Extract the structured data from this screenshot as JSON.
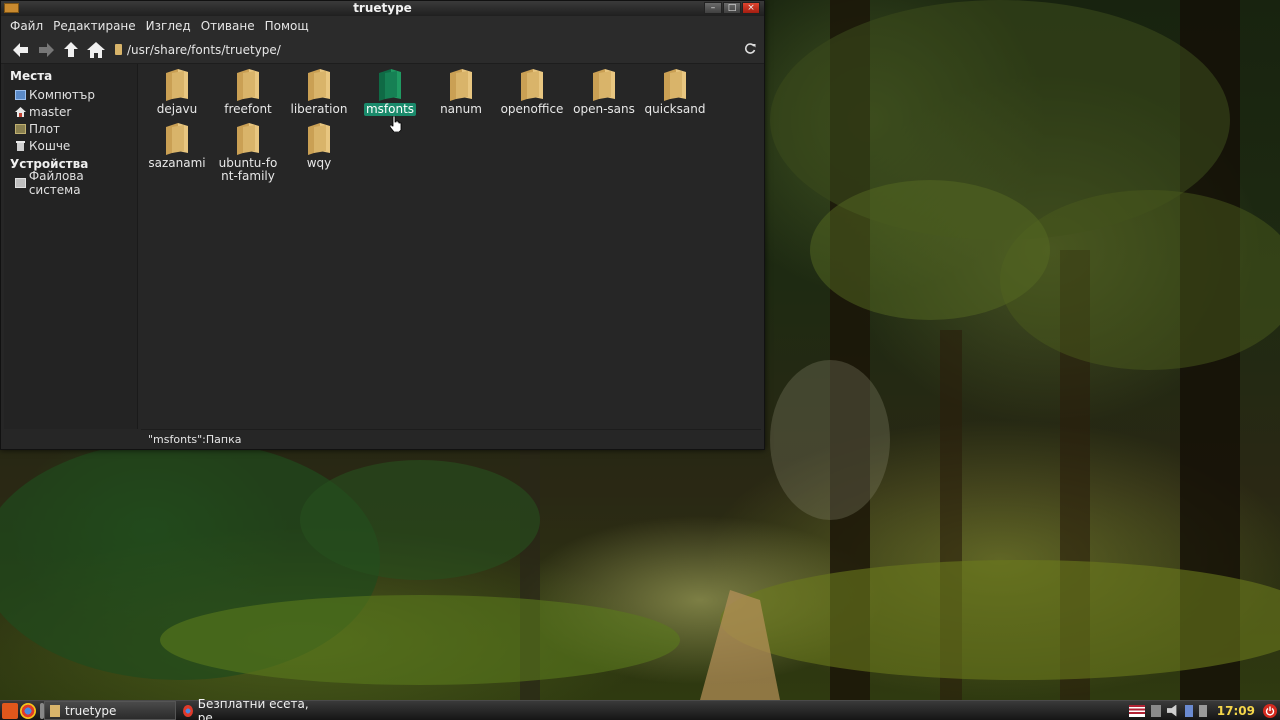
{
  "window": {
    "title": "truetype",
    "menu": [
      "Файл",
      "Редактиране",
      "Изглед",
      "Отиване",
      "Помощ"
    ],
    "location": "/usr/share/fonts/truetype/"
  },
  "sidebar": {
    "places_heading": "Места",
    "places": [
      {
        "label": "Компютър",
        "icon": "computer-icon"
      },
      {
        "label": "master",
        "icon": "home-icon"
      },
      {
        "label": "Плот",
        "icon": "desktop-icon"
      },
      {
        "label": "Кошче",
        "icon": "trash-icon"
      }
    ],
    "devices_heading": "Устройства",
    "devices": [
      {
        "label": "Файлова система",
        "icon": "drive-icon"
      }
    ]
  },
  "files": [
    {
      "name": "dejavu"
    },
    {
      "name": "freefont"
    },
    {
      "name": "liberation"
    },
    {
      "name": "msfonts",
      "selected": true
    },
    {
      "name": "nanum"
    },
    {
      "name": "openoffice"
    },
    {
      "name": "open-sans"
    },
    {
      "name": "quicksand"
    },
    {
      "name": "sazanami"
    },
    {
      "name": "ubuntu-font-family"
    },
    {
      "name": "wqy"
    }
  ],
  "status": "\"msfonts\":Папка",
  "taskbar": {
    "tasks": [
      "truetype",
      "Безплатни есета, ре..."
    ],
    "clock": "17:09"
  },
  "colors": {
    "selection": "#1a8a6b",
    "folder": "#d8b46a",
    "clock": "#f5d64a"
  }
}
